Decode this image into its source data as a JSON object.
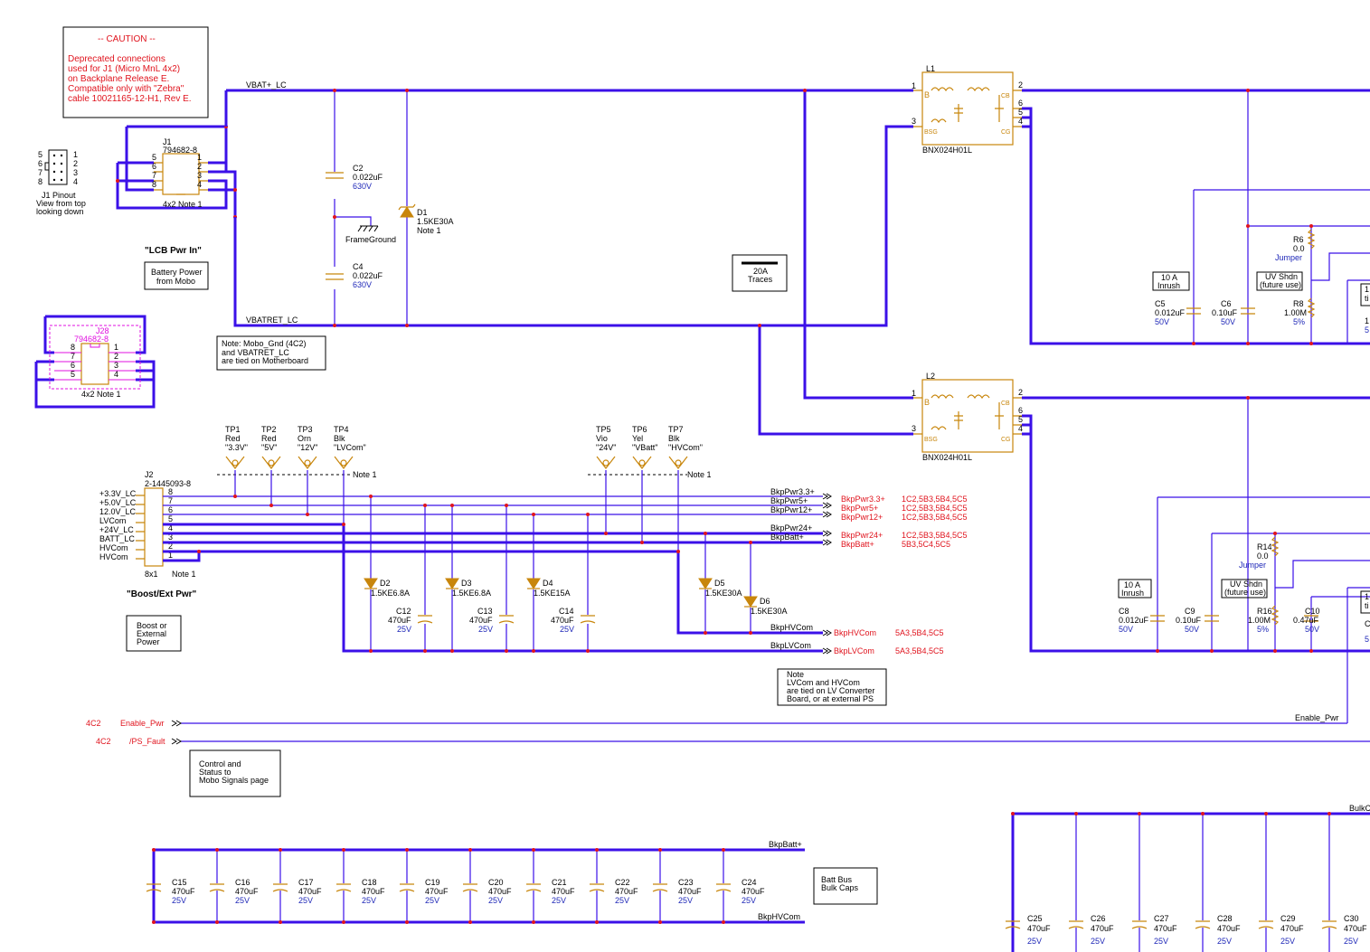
{
  "caution": {
    "title": "-- CAUTION --",
    "lines": [
      "Deprecated connections",
      "used for J1 (Micro MnL 4x2)",
      "on Backplane Release E.",
      "Compatible only with \"Zebra\"",
      "cable 10021165-12-H1, Rev E."
    ]
  },
  "j1pinout": {
    "left_pins": [
      "5",
      "6",
      "7",
      "8"
    ],
    "right_pins": [
      "1",
      "2",
      "3",
      "4"
    ],
    "lines": [
      "J1 Pinout",
      "View from top",
      "looking down"
    ]
  },
  "j1": {
    "ref": "J1",
    "part": "794682-8",
    "left_pins": [
      "5",
      "6",
      "7",
      "8"
    ],
    "right_pins": [
      "1",
      "2",
      "3",
      "4"
    ],
    "footer": "4x2  Note 1"
  },
  "lcb": {
    "heading": "\"LCB Pwr In\"",
    "box_lines": [
      "Battery Power",
      "from Mobo"
    ]
  },
  "j28": {
    "ref": "J28",
    "part": "794682-8",
    "left_pins": [
      "8",
      "7",
      "6",
      "5"
    ],
    "right_pins": [
      "1",
      "2",
      "3",
      "4"
    ],
    "footer": "4x2  Note 1"
  },
  "nets": {
    "vbat_plus": "VBAT+_LC",
    "vbatret": "VBATRET_LC",
    "frameground": "FrameGround",
    "enable_pwr": "Enable_Pwr",
    "bulk": "BulkC"
  },
  "c2": {
    "ref": "C2",
    "value": "0.022uF",
    "voltage": "630V"
  },
  "c4": {
    "ref": "C4",
    "value": "0.022uF",
    "voltage": "630V"
  },
  "d1": {
    "ref": "D1",
    "value": "1.5KE30A",
    "note": "Note 1"
  },
  "note_mobo": [
    "Note:     Mobo_Gnd (4C2)",
    "and  VBATRET_LC",
    "are tied on Motherboard"
  ],
  "traces": {
    "line1": "20A",
    "line2": "Traces"
  },
  "l1": {
    "ref": "L1",
    "part": "BNX024H01L",
    "pins": [
      "1",
      "3",
      "2",
      "6",
      "5",
      "4"
    ],
    "labels": [
      "B",
      "BSG",
      "CB",
      "CG"
    ]
  },
  "l2": {
    "ref": "L2",
    "part": "BNX024H01L",
    "pins": [
      "1",
      "3",
      "2",
      "6",
      "5",
      "4"
    ],
    "labels": [
      "B",
      "BSG",
      "CB",
      "CG"
    ]
  },
  "right_upper": {
    "inrush": [
      "10 A",
      "Inrush"
    ],
    "c5": {
      "ref": "C5",
      "value": "0.012uF",
      "voltage": "50V"
    },
    "c6": {
      "ref": "C6",
      "value": "0.10uF",
      "voltage": "50V"
    },
    "r6": {
      "ref": "R6",
      "value": "0.0",
      "note": "Jumper"
    },
    "uv": [
      "UV Shdn",
      "(future use)"
    ],
    "r8": {
      "ref": "R8",
      "value": "1.00M",
      "tol": "5%"
    },
    "edge": [
      "1",
      "ti",
      "1",
      "5"
    ]
  },
  "right_lower": {
    "inrush": [
      "10 A",
      "Inrush"
    ],
    "c8": {
      "ref": "C8",
      "value": "0.012uF",
      "voltage": "50V"
    },
    "c9": {
      "ref": "C9",
      "value": "0.10uF",
      "voltage": "50V"
    },
    "r14": {
      "ref": "R14",
      "value": "0.0",
      "note": "Jumper"
    },
    "uv": [
      "UV Shdn",
      "(future use)"
    ],
    "r16": {
      "ref": "R16",
      "value": "1.00M",
      "tol": "5%"
    },
    "c10": {
      "ref": "C10",
      "value": "0.47uF",
      "voltage": "50V"
    },
    "edge": [
      "1",
      "ti",
      "C",
      "5"
    ]
  },
  "testpoints": [
    {
      "ref": "TP1",
      "color": "Red",
      "label": "\"3.3V\""
    },
    {
      "ref": "TP2",
      "color": "Red",
      "label": "\"5V\""
    },
    {
      "ref": "TP3",
      "color": "Orn",
      "label": "\"12V\""
    },
    {
      "ref": "TP4",
      "color": "Blk",
      "label": "\"LVCom\""
    },
    {
      "ref": "TP5",
      "color": "Vio",
      "label": "\"24V\""
    },
    {
      "ref": "TP6",
      "color": "Yel",
      "label": "\"VBatt\""
    },
    {
      "ref": "TP7",
      "color": "Blk",
      "label": "\"HVCom\""
    }
  ],
  "tp_note": "Note 1",
  "j2": {
    "ref": "J2",
    "part": "2-1445093-8",
    "pin_labels": [
      "+3.3V_LC",
      "+5.0V_LC",
      "12.0V_LC",
      "LVCom",
      "+24V_LC",
      "BATT_LC",
      "HVCom",
      "HVCom"
    ],
    "pins": [
      "8",
      "7",
      "6",
      "5",
      "4",
      "3",
      "2",
      "1"
    ],
    "footer": "8x1",
    "note": "Note 1"
  },
  "boost": {
    "heading": "\"Boost/Ext Pwr\"",
    "box_lines": [
      "Boost or",
      "External",
      "Power"
    ]
  },
  "bus_labels": {
    "top": [
      "BkpPwr3.3+",
      "BkpPwr5+",
      "BkpPwr12+"
    ],
    "mid": [
      "BkpPwr24+",
      "BkpBatt+"
    ],
    "hv": "BkpHVCom",
    "lv": "BkpLVCom"
  },
  "offpage": [
    {
      "name": "BkpPwr3.3+",
      "ref": "1C2,5B3,5B4,5C5"
    },
    {
      "name": "BkpPwr5+",
      "ref": "1C2,5B3,5B4,5C5"
    },
    {
      "name": "BkpPwr12+",
      "ref": "1C2,5B3,5B4,5C5"
    },
    {
      "name": "BkpPwr24+",
      "ref": "1C2,5B3,5B4,5C5"
    },
    {
      "name": "BkpBatt+",
      "ref": "5B3,5C4,5C5"
    },
    {
      "name": "BkpHVCom",
      "ref": "5A3,5B4,5C5"
    },
    {
      "name": "BkpLVCom",
      "ref": "5A3,5B4,5C5"
    }
  ],
  "diodes": [
    {
      "ref": "D2",
      "value": "1.5KE6.8A"
    },
    {
      "ref": "D3",
      "value": "1.5KE6.8A"
    },
    {
      "ref": "D4",
      "value": "1.5KE15A"
    },
    {
      "ref": "D5",
      "value": "1.5KE30A"
    },
    {
      "ref": "D6",
      "value": "1.5KE30A"
    }
  ],
  "mid_caps": [
    {
      "ref": "C12",
      "value": "470uF",
      "voltage": "25V"
    },
    {
      "ref": "C13",
      "value": "470uF",
      "voltage": "25V"
    },
    {
      "ref": "C14",
      "value": "470uF",
      "voltage": "25V"
    }
  ],
  "note_lv": [
    "Note",
    "LVCom and HVCom",
    "are tied on LV Converter",
    "Board, or at external PS"
  ],
  "signals": [
    {
      "ref": "4C2",
      "name": "Enable_Pwr"
    },
    {
      "ref": "4C2",
      "name": "/PS_Fault"
    }
  ],
  "control_box": [
    "Control and",
    "Status to",
    "Mobo Signals page"
  ],
  "bulk_bottom": {
    "top_net": "BkpBatt+",
    "bottom_net": "BkpHVCom",
    "box": [
      "Batt Bus",
      "Bulk Caps"
    ],
    "caps": [
      {
        "ref": "C15",
        "value": "470uF",
        "voltage": "25V"
      },
      {
        "ref": "C16",
        "value": "470uF",
        "voltage": "25V"
      },
      {
        "ref": "C17",
        "value": "470uF",
        "voltage": "25V"
      },
      {
        "ref": "C18",
        "value": "470uF",
        "voltage": "25V"
      },
      {
        "ref": "C19",
        "value": "470uF",
        "voltage": "25V"
      },
      {
        "ref": "C20",
        "value": "470uF",
        "voltage": "25V"
      },
      {
        "ref": "C21",
        "value": "470uF",
        "voltage": "25V"
      },
      {
        "ref": "C22",
        "value": "470uF",
        "voltage": "25V"
      },
      {
        "ref": "C23",
        "value": "470uF",
        "voltage": "25V"
      },
      {
        "ref": "C24",
        "value": "470uF",
        "voltage": "25V"
      }
    ]
  },
  "bulk_right": {
    "caps": [
      {
        "ref": "C25",
        "value": "470uF",
        "voltage": "25V"
      },
      {
        "ref": "C26",
        "value": "470uF",
        "voltage": "25V"
      },
      {
        "ref": "C27",
        "value": "470uF",
        "voltage": "25V"
      },
      {
        "ref": "C28",
        "value": "470uF",
        "voltage": "25V"
      },
      {
        "ref": "C29",
        "value": "470uF",
        "voltage": "25V"
      },
      {
        "ref": "C30",
        "value": "470uF",
        "voltage": "25V"
      }
    ]
  }
}
